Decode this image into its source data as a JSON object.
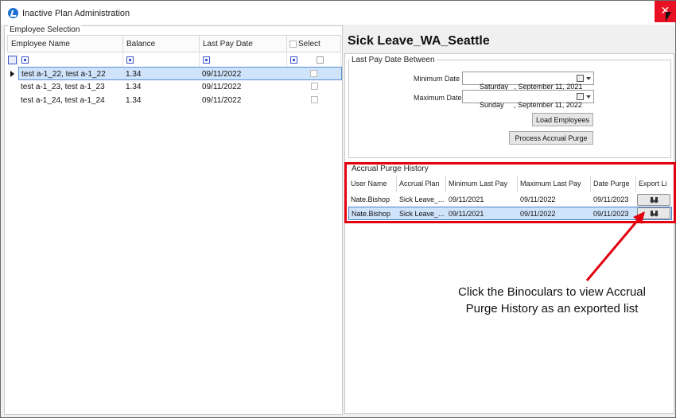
{
  "window": {
    "title": "Inactive Plan Administration",
    "close_glyph": "✕"
  },
  "employee_selection": {
    "group_label": "Employee Selection",
    "columns": [
      "Employee Name",
      "Balance",
      "Last Pay Date",
      "Select"
    ],
    "rows": [
      {
        "name": "test a-1_22, test a-1_22",
        "balance": "1.34",
        "last_pay_date": "09/11/2022",
        "selected": false
      },
      {
        "name": "test a-1_23, test a-1_23",
        "balance": "1.34",
        "last_pay_date": "09/11/2022",
        "selected": false
      },
      {
        "name": "test a-1_24, test a-1_24",
        "balance": "1.34",
        "last_pay_date": "09/11/2022",
        "selected": false
      }
    ]
  },
  "plan": {
    "title": "Sick Leave_WA_Seattle",
    "date_group_label": "Last Pay Date Between",
    "min_date_label": "Minimum Date",
    "min_date_value": "Saturday   , September 11, 2021",
    "max_date_label": "Maximum Date",
    "max_date_value": "Sunday     , September 11, 2022",
    "load_button": "Load Employees",
    "process_button": "Process Accrual Purge"
  },
  "accrual_history": {
    "group_label": "Accrual Purge History",
    "columns": [
      "User Name",
      "Accrual Plan",
      "Minimum Last Pay",
      "Maximum Last Pay",
      "Date Purge",
      "Export Li"
    ],
    "rows": [
      {
        "user": "Nate.Bishop",
        "plan": "Sick Leave_...",
        "min_last_pay": "09/11/2021",
        "max_last_pay": "09/11/2022",
        "date_purge": "09/11/2023",
        "export_icon": "binoculars-icon"
      },
      {
        "user": "Nate.Bishop",
        "plan": "Sick Leave_...",
        "min_last_pay": "09/11/2021",
        "max_last_pay": "09/11/2022",
        "date_purge": "09/11/2023",
        "export_icon": "binoculars-icon"
      }
    ]
  },
  "annotation": {
    "line1": "Click the Binoculars to view Accrual",
    "line2": "Purge History as an exported list",
    "color": "#e0000e"
  }
}
